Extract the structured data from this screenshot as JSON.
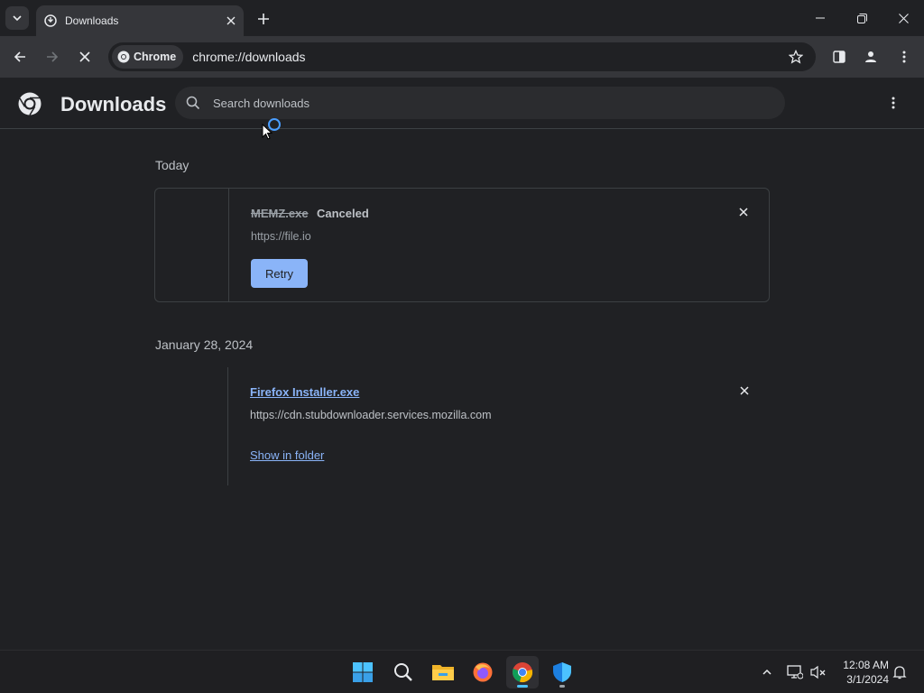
{
  "tab": {
    "title": "Downloads"
  },
  "omnibox": {
    "chip_label": "Chrome",
    "url": "chrome://downloads"
  },
  "page": {
    "title": "Downloads",
    "search_placeholder": "Search downloads"
  },
  "groups": [
    {
      "date": "Today",
      "items": [
        {
          "filename": "MEMZ.exe",
          "status": "Canceled",
          "source": "https://file.io",
          "action": "Retry"
        }
      ]
    },
    {
      "date": "January 28, 2024",
      "items": [
        {
          "filename": "Firefox Installer.exe",
          "source": "https://cdn.stubdownloader.services.mozilla.com",
          "action": "Show in folder"
        }
      ]
    }
  ],
  "taskbar": {
    "apps": [
      "windows-start-icon",
      "search-icon",
      "file-explorer-icon",
      "firefox-icon",
      "chrome-icon",
      "defender-icon"
    ],
    "clock_time": "12:08 AM",
    "clock_date": "3/1/2024"
  },
  "colors": {
    "accent": "#8ab4f8",
    "background": "#202124",
    "toolbar": "#35363a"
  }
}
